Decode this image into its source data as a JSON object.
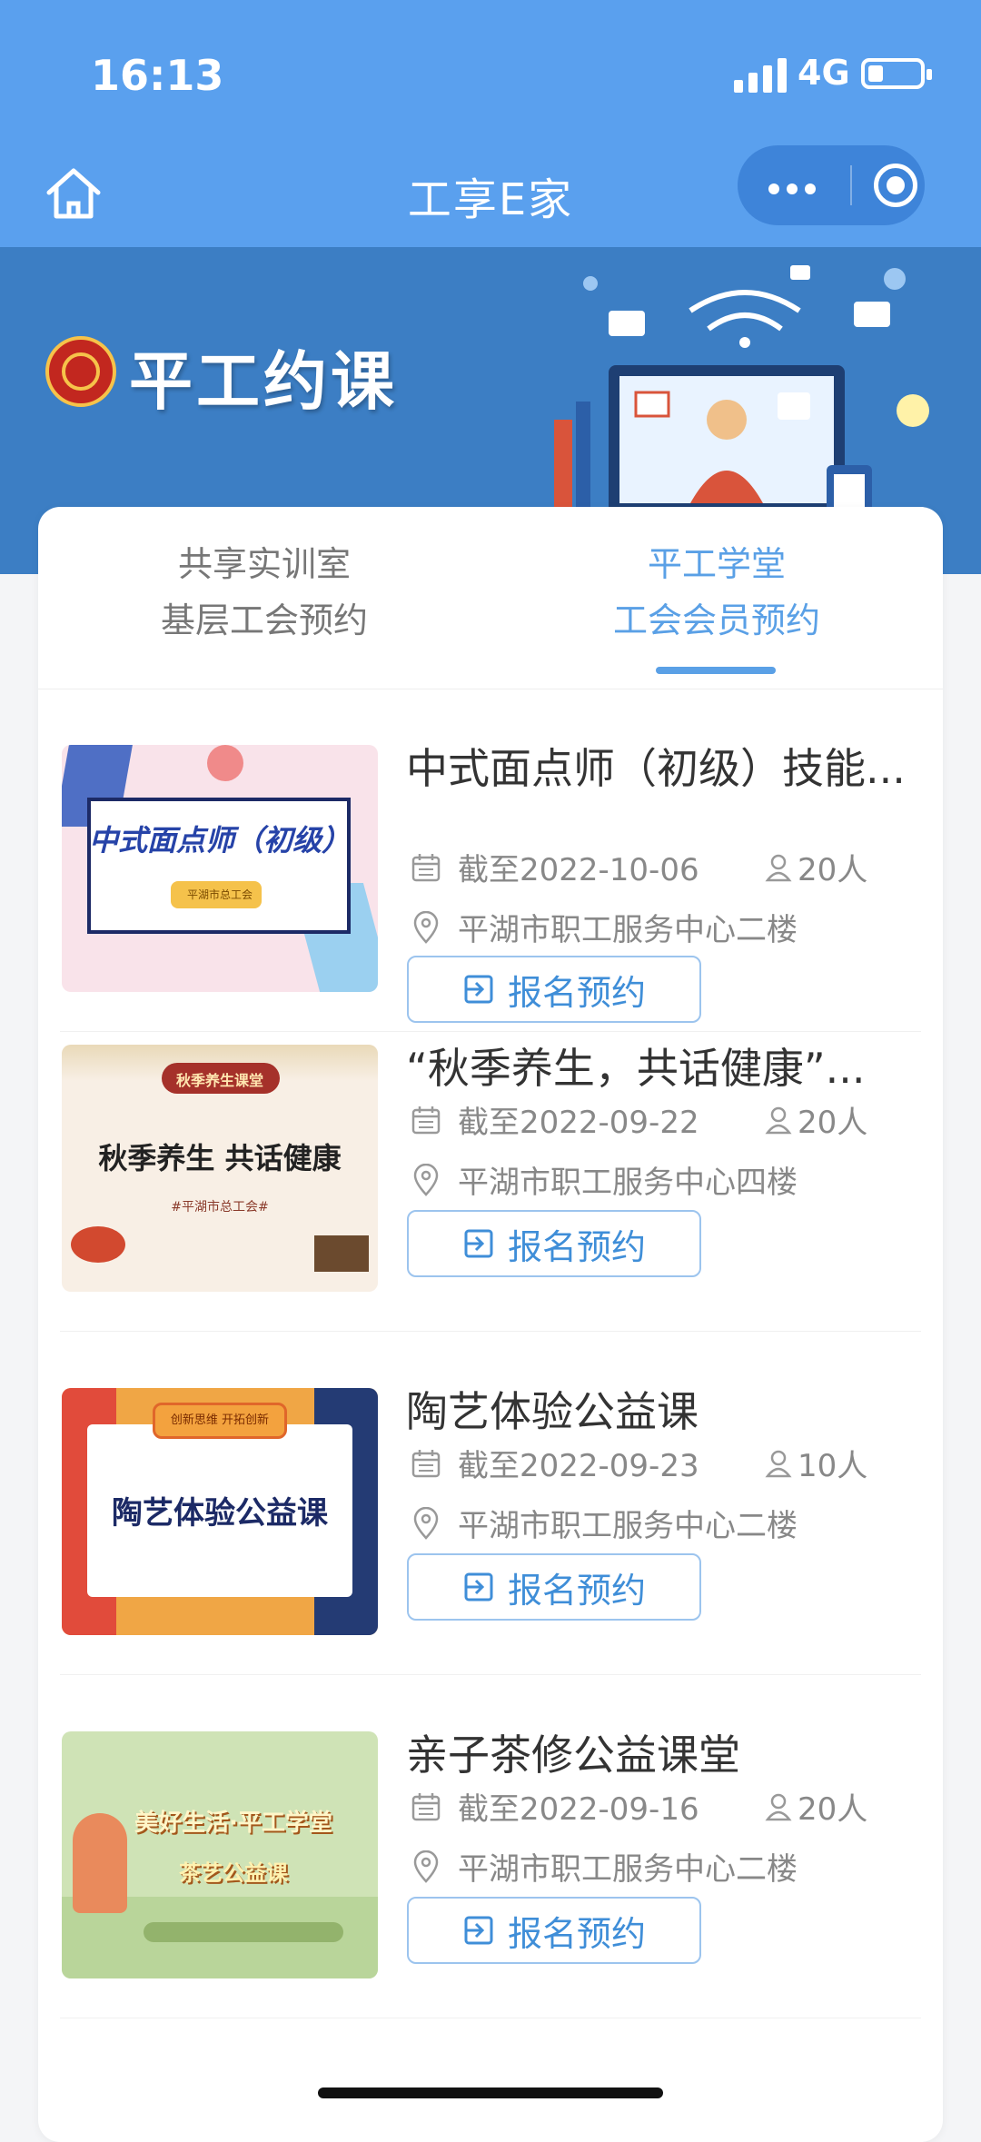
{
  "status_bar": {
    "time": "16:13",
    "network": "4G"
  },
  "nav": {
    "title": "工享E家"
  },
  "banner": {
    "title": "平工约课"
  },
  "tabs": [
    {
      "line1": "共享实训室",
      "line2": "基层工会预约",
      "active": false
    },
    {
      "line1": "平工学堂",
      "line2": "工会会员预约",
      "active": true
    }
  ],
  "courses": [
    {
      "title": "中式面点师（初级）技能...",
      "deadline": "截至2022-10-06",
      "capacity": "20人",
      "location": "平湖市职工服务中心二楼",
      "button": "报名预约",
      "thumb": {
        "main": "中式面点师（初级）",
        "sub": "平湖市总工会",
        "icon": "pastry-poster-thumbnail"
      }
    },
    {
      "title": "“秋季养生，共话健康”...",
      "deadline": "截至2022-09-22",
      "capacity": "20人",
      "location": "平湖市职工服务中心四楼",
      "button": "报名预约",
      "thumb": {
        "main": "秋季养生 共话健康",
        "top": "秋季养生课堂",
        "sub": "#平湖市总工会#",
        "icon": "autumn-health-poster-thumbnail"
      }
    },
    {
      "title": "陶艺体验公益课",
      "deadline": "截至2022-09-23",
      "capacity": "10人",
      "location": "平湖市职工服务中心二楼",
      "button": "报名预约",
      "thumb": {
        "main": "陶艺体验公益课",
        "top": "创新思维 开拓创新",
        "icon": "pottery-poster-thumbnail"
      }
    },
    {
      "title": "亲子茶修公益课堂",
      "deadline": "截至2022-09-16",
      "capacity": "20人",
      "location": "平湖市职工服务中心二楼",
      "button": "报名预约",
      "thumb": {
        "main": "美好生活·平工学堂",
        "sub": "茶艺公益课",
        "icon": "tea-class-poster-thumbnail"
      }
    }
  ],
  "colors": {
    "primary": "#5aa0ee",
    "banner": "#3c7ec4",
    "accent": "#5aa0e6",
    "button_text": "#3f8ed8"
  }
}
